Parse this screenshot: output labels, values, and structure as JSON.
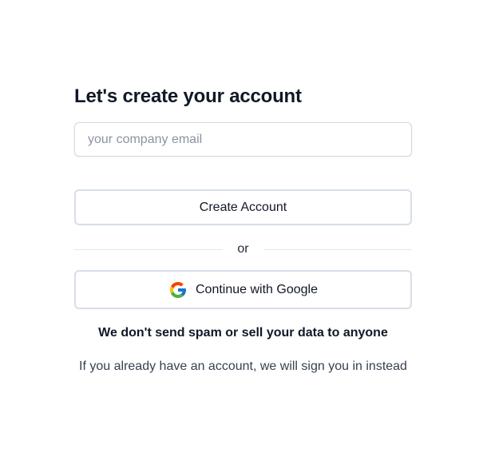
{
  "form": {
    "title": "Let's create your account",
    "email_placeholder": "your company email",
    "email_value": "",
    "create_button_label": "Create Account",
    "divider_text": "or",
    "google_button_label": "Continue with Google",
    "google_icon": "google-g-logo",
    "notice": "We don't send spam or sell your data to anyone",
    "subtext": "If you already have an account, we will sign you in instead"
  },
  "colors": {
    "input_border": "#d1d9e3",
    "button_border": "#d6dee8",
    "divider_line": "#e3e7ec",
    "placeholder": "#8a94a3",
    "text": "#111827"
  }
}
